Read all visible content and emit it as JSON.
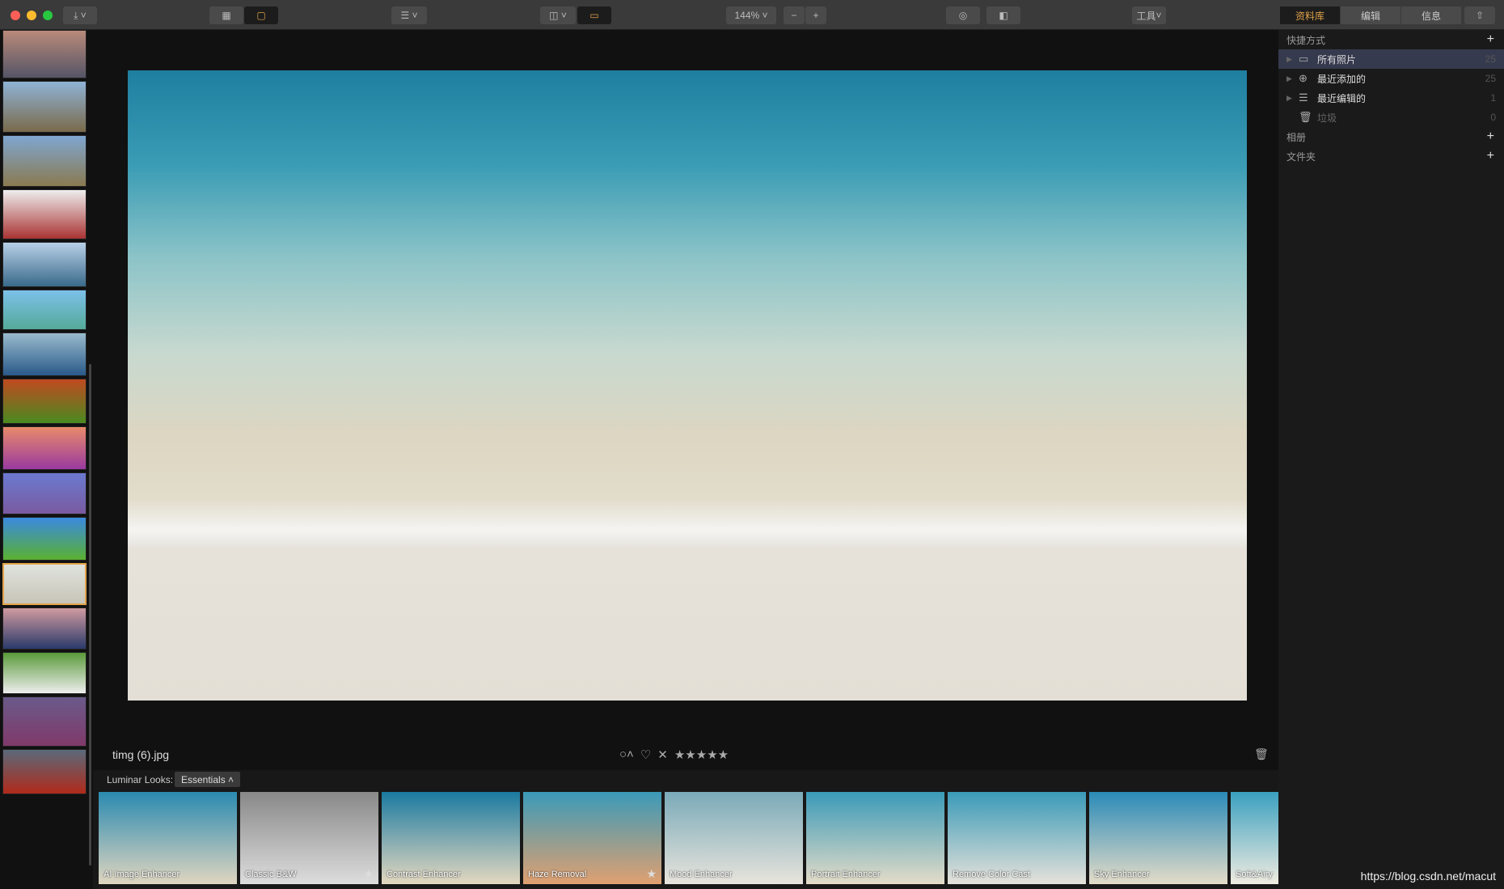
{
  "toolbar": {
    "zoom": "144%",
    "zoom_out": "−",
    "zoom_in": "+",
    "tools": "工具",
    "tabs": [
      "资料库",
      "编辑",
      "信息"
    ],
    "accent": "#e0a24a"
  },
  "sidebar": {
    "shortcuts": "快捷方式",
    "items": [
      {
        "label": "所有照片",
        "count": "25",
        "icon": "stack-icon"
      },
      {
        "label": "最近添加的",
        "count": "25",
        "icon": "plus-circle-icon"
      },
      {
        "label": "最近编辑的",
        "count": "1",
        "icon": "sliders-icon"
      },
      {
        "label": "垃圾",
        "count": "0",
        "icon": "trash-icon"
      }
    ],
    "albums": "相册",
    "folders": "文件夹"
  },
  "photo": {
    "filename": "timg (6).jpg",
    "stars": "★★★★★",
    "reject": "✕",
    "heart": "♡",
    "flag": "○˄"
  },
  "looks": {
    "label": "Luminar Looks:",
    "collection": "Essentials ˄",
    "items": [
      {
        "name": "AI Image Enhancer",
        "fav": false
      },
      {
        "name": "Classic B&W",
        "fav": true
      },
      {
        "name": "Contrast Enhancer",
        "fav": false
      },
      {
        "name": "Haze Removal",
        "fav": true
      },
      {
        "name": "Mood Enhancer",
        "fav": false
      },
      {
        "name": "Portrait Enhancer",
        "fav": false
      },
      {
        "name": "Remove Color Cast",
        "fav": false
      },
      {
        "name": "Sky Enhancer",
        "fav": false
      },
      {
        "name": "Soft&Airy",
        "fav": false
      }
    ]
  },
  "watermark": "https://blog.csdn.net/macut"
}
